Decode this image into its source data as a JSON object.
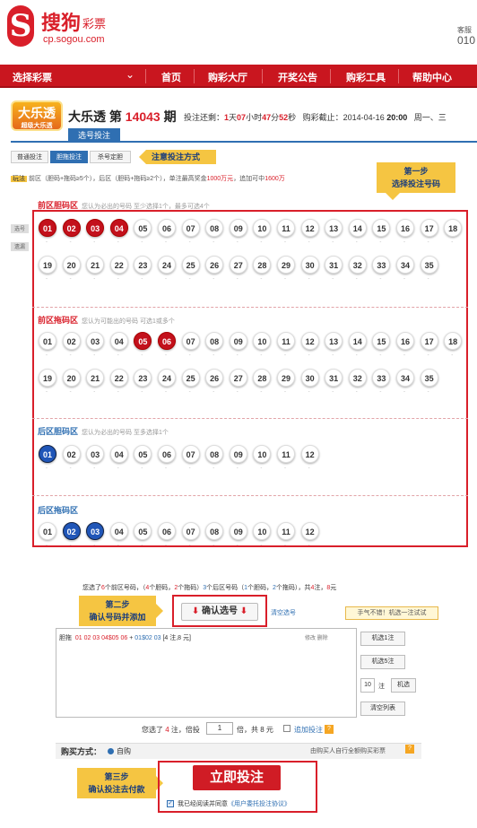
{
  "header": {
    "logo_letter": "S",
    "brand": "搜狗",
    "brand_sub": "彩票",
    "domain": "cp.sogou.com",
    "corner_line1": "客服",
    "corner_line2": "010"
  },
  "nav": {
    "select_label": "选择彩票",
    "items": [
      "首页",
      "购彩大厅",
      "开奖公告",
      "购彩工具",
      "帮助中心"
    ]
  },
  "lottery": {
    "logo_text": "大乐透",
    "logo_sub": "超级大乐透",
    "name": "大乐透",
    "di": "第",
    "issue": "14043",
    "qi": "期",
    "countdown_prefix": "投注还剩：",
    "d": "1",
    "d_unit": "天",
    "h": "07",
    "h_unit": "小时",
    "m": "47",
    "m_unit": "分",
    "s": "52",
    "s_unit": "秒",
    "deadline_label": "购彩截止：2014-04-16",
    "deadline_time": "20:00",
    "deadline_week": "周一、三"
  },
  "tabs": {
    "main": "选号投注",
    "sub": [
      "普通投注",
      "胆拖投注",
      "杀号定胆"
    ],
    "hint": "注意投注方式"
  },
  "rule": {
    "tag": "玩法",
    "text1": "前区（胆码+拖码≥5个），后区（胆码+拖码≥2个），单注最高奖金",
    "amount1": "1000万元",
    "text2": "，追加可中",
    "amount2": "1600万"
  },
  "steps": {
    "step1_line1": "第一步",
    "step1_line2": "选择投注号码",
    "step2_line1": "第二步",
    "step2_line2": "确认号码并添加",
    "step3_line1": "第三步",
    "step3_line2": "确认投注去付款"
  },
  "side": {
    "btn1": "选号",
    "btn2": "遗漏"
  },
  "sections": [
    {
      "title": "前区胆码区",
      "hint": "您认为必出的号码 至少选择1个，最多可选4个"
    },
    {
      "title": "前区拖码区",
      "hint": "您认为可能出的号码 可选1或多个"
    },
    {
      "title": "后区胆码区",
      "hint": "您认为必出的号码 至多选择1个"
    },
    {
      "title": "后区拖码区",
      "hint": ""
    }
  ],
  "front_balls": [
    "01",
    "02",
    "03",
    "04",
    "05",
    "06",
    "07",
    "08",
    "09",
    "10",
    "11",
    "12",
    "13",
    "14",
    "15",
    "16",
    "17",
    "18",
    "19",
    "20",
    "21",
    "22",
    "23",
    "24",
    "25",
    "26",
    "27",
    "28",
    "29",
    "30",
    "31",
    "32",
    "33",
    "34",
    "35"
  ],
  "back_balls": [
    "01",
    "02",
    "03",
    "04",
    "05",
    "06",
    "07",
    "08",
    "09",
    "10",
    "11",
    "12"
  ],
  "selected": {
    "front_dan": [
      "01",
      "02",
      "03",
      "04"
    ],
    "front_tuo": [
      "05",
      "06"
    ],
    "back_dan": [
      "01"
    ],
    "back_tuo": [
      "02",
      "03"
    ]
  },
  "miss_placeholder": "-",
  "summary": {
    "p1": "您选了",
    "n1": "6",
    "p2": "个前区号码，（",
    "n2": "4",
    "p3": "个胆码，",
    "n3": "2",
    "p4": "个拖码）",
    "n4": "3",
    "p5": "个后区号码（",
    "n5": "1",
    "p6": "个胆码，",
    "n6": "2",
    "p7": "个拖码），共",
    "n7": "4",
    "p8": "注，",
    "n8": "8",
    "p9": "元"
  },
  "confirm": {
    "label": "确认选号",
    "arrow": "⬇",
    "clear": "清空选号",
    "lucky": "手气不错！机选一注试试"
  },
  "bet_list": {
    "type": "胆拖",
    "front": "01 02 03 04$05 06",
    "plus": "+",
    "back": "01$02 03",
    "detail": "[4 注,8 元]",
    "actions": "修改 删除"
  },
  "side_btns": {
    "machine1": "机选1注",
    "machine5": "机选5注",
    "count": "10",
    "zhu": "注",
    "machine": "机选",
    "clear_list": "清空列表"
  },
  "multiple": {
    "prefix": "您选了",
    "zhu": "4",
    "mid": "注，倍投",
    "value": "1",
    "suffix": "倍，共",
    "total": "8",
    "yuan": "元",
    "chase": "追加投注",
    "help": "?"
  },
  "pay": {
    "label": "购买方式：",
    "self": "自购",
    "entrust": "由购买人自行全额购买彩票",
    "help": "?"
  },
  "submit": {
    "label": "立即投注",
    "check": "✓",
    "agree_pre": "我已经阅读并同意",
    "agree_link": "《用户委托投注协议》"
  }
}
